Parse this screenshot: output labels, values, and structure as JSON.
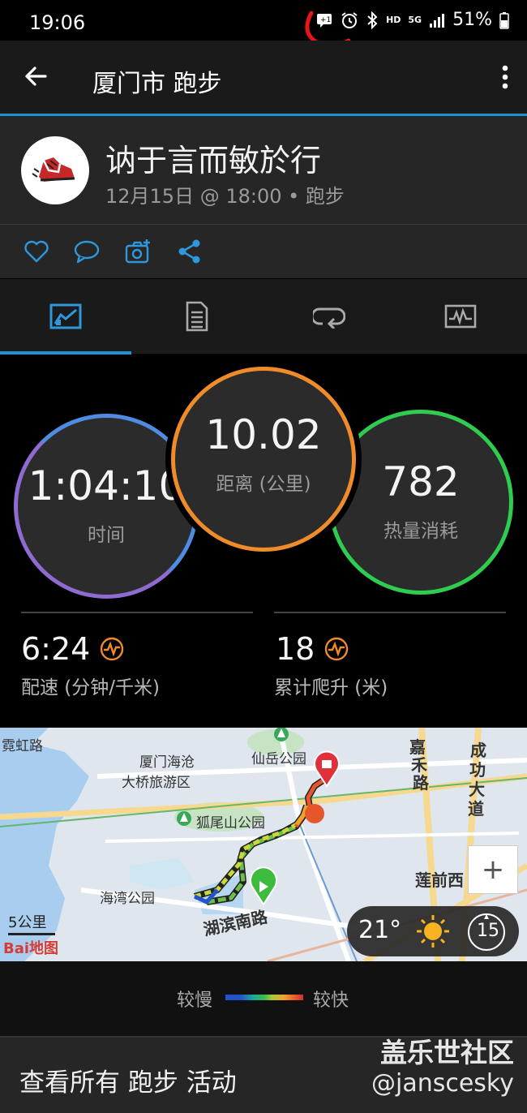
{
  "status_bar": {
    "time": "19:06",
    "hd": "HD",
    "network": "5G",
    "battery": "51%"
  },
  "app_bar": {
    "title": "厦门市 跑步",
    "back_icon": "arrow-left-icon",
    "menu_icon": "more-vertical-icon"
  },
  "activity": {
    "name": "讷于言而敏於行",
    "meta": "12月15日 @ 18:00 • 跑步"
  },
  "actions": [
    "heart-icon",
    "comment-icon",
    "add-photo-icon",
    "share-icon"
  ],
  "tabs": [
    "stats-chart-tab",
    "details-tab",
    "laps-tab",
    "graph-tab"
  ],
  "stats": {
    "time": {
      "value": "1:04:10",
      "label": "时间",
      "color": "#5b7fd1"
    },
    "distance": {
      "value": "10.02",
      "label": "距离 (公里)",
      "color": "#f08b2a"
    },
    "calories": {
      "value": "782",
      "label": "热量消耗",
      "color": "#2ecc4f"
    }
  },
  "metrics": {
    "pace": {
      "value": "6:24",
      "label": "配速 (分钟/千米)"
    },
    "ascent": {
      "value": "18",
      "label": "累计爬升 (米)"
    }
  },
  "map": {
    "labels": {
      "rainbow_road": "霓虹路",
      "xiamen_bridge_1": "厦门海沧",
      "xiamen_bridge_2": "大桥旅游区",
      "xianyue": "仙岳公园",
      "huwei": "狐尾山公园",
      "haiwan": "海湾公园",
      "hubin": "湖滨南路",
      "lianqian": "莲前西",
      "jiahe_1": "嘉",
      "jiahe_2": "禾",
      "jiahe_3": "路",
      "chenggong_1": "成",
      "chenggong_2": "功",
      "chenggong_3": "大",
      "chenggong_4": "道"
    },
    "scale": "5公里",
    "logo": "Bai地图",
    "zoom_in": "+",
    "weather": {
      "temp": "21°",
      "wind": "15"
    }
  },
  "legend": {
    "slow": "较慢",
    "fast": "较快"
  },
  "footer": {
    "view_all": "查看所有 跑步 活动"
  },
  "watermark": {
    "line1": "盖乐世社区",
    "line2": "@janscesky"
  }
}
